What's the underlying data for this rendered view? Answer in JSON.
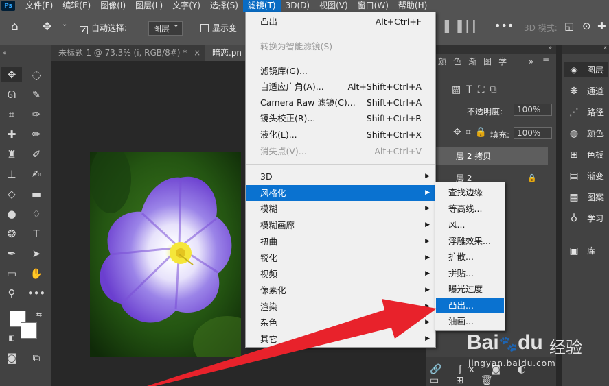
{
  "menubar": {
    "logo": "Ps",
    "items": [
      "文件(F)",
      "编辑(E)",
      "图像(I)",
      "图层(L)",
      "文字(Y)",
      "选择(S)",
      "滤镜(T)",
      "3D(D)",
      "视图(V)",
      "窗口(W)",
      "帮助(H)"
    ]
  },
  "options": {
    "auto_select_label": "自动选择:",
    "auto_select_value": "图层",
    "show_transform_label": "显示变",
    "mode_3d_label": "3D 模式:"
  },
  "tabs": {
    "doc1": "未标题-1 @ 73.3% (i, RGB/8#) *",
    "doc1_close": "×",
    "doc2": "暗恋.pn"
  },
  "filter_menu": {
    "items": [
      {
        "label": "凸出",
        "shortcut": "Alt+Ctrl+F"
      },
      {
        "label": "转换为智能滤镜(S)",
        "disabled": true
      },
      {
        "label": "滤镜库(G)..."
      },
      {
        "label": "自适应广角(A)...",
        "shortcut": "Alt+Shift+Ctrl+A"
      },
      {
        "label": "Camera Raw 滤镜(C)...",
        "shortcut": "Shift+Ctrl+A"
      },
      {
        "label": "镜头校正(R)...",
        "shortcut": "Shift+Ctrl+R"
      },
      {
        "label": "液化(L)...",
        "shortcut": "Shift+Ctrl+X"
      },
      {
        "label": "消失点(V)...",
        "shortcut": "Alt+Ctrl+V",
        "disabled": true
      },
      {
        "label": "3D"
      },
      {
        "label": "风格化",
        "highlighted": true
      },
      {
        "label": "模糊"
      },
      {
        "label": "模糊画廊"
      },
      {
        "label": "扭曲"
      },
      {
        "label": "锐化"
      },
      {
        "label": "视频"
      },
      {
        "label": "像素化"
      },
      {
        "label": "渲染"
      },
      {
        "label": "杂色"
      },
      {
        "label": "其它"
      }
    ]
  },
  "stylize_submenu": {
    "items": [
      "查找边缘",
      "等高线...",
      "风...",
      "浮雕效果...",
      "扩散...",
      "拼贴...",
      "曝光过度",
      "凸出...",
      "油画..."
    ],
    "highlighted": "凸出..."
  },
  "layers_panel": {
    "tabs": [
      "颜",
      "色",
      "渐",
      "图",
      "学"
    ],
    "opacity_label": "不透明度:",
    "opacity_value": "100%",
    "fill_label": "填充:",
    "fill_value": "100%",
    "layer1": "层 2 拷贝",
    "layer2": "层 2"
  },
  "side_panel": {
    "items": [
      "图层",
      "通道",
      "路径",
      "颜色",
      "色板",
      "渐变",
      "图案",
      "学习",
      "库"
    ]
  },
  "watermark": {
    "brand": "Bai",
    "brand2": "du",
    "cn": "经验",
    "url": "jingyan.baidu.com"
  },
  "colors": {
    "menu_bg": "#535353",
    "highlight": "#0a72d0",
    "arrow": "#e8222b"
  }
}
